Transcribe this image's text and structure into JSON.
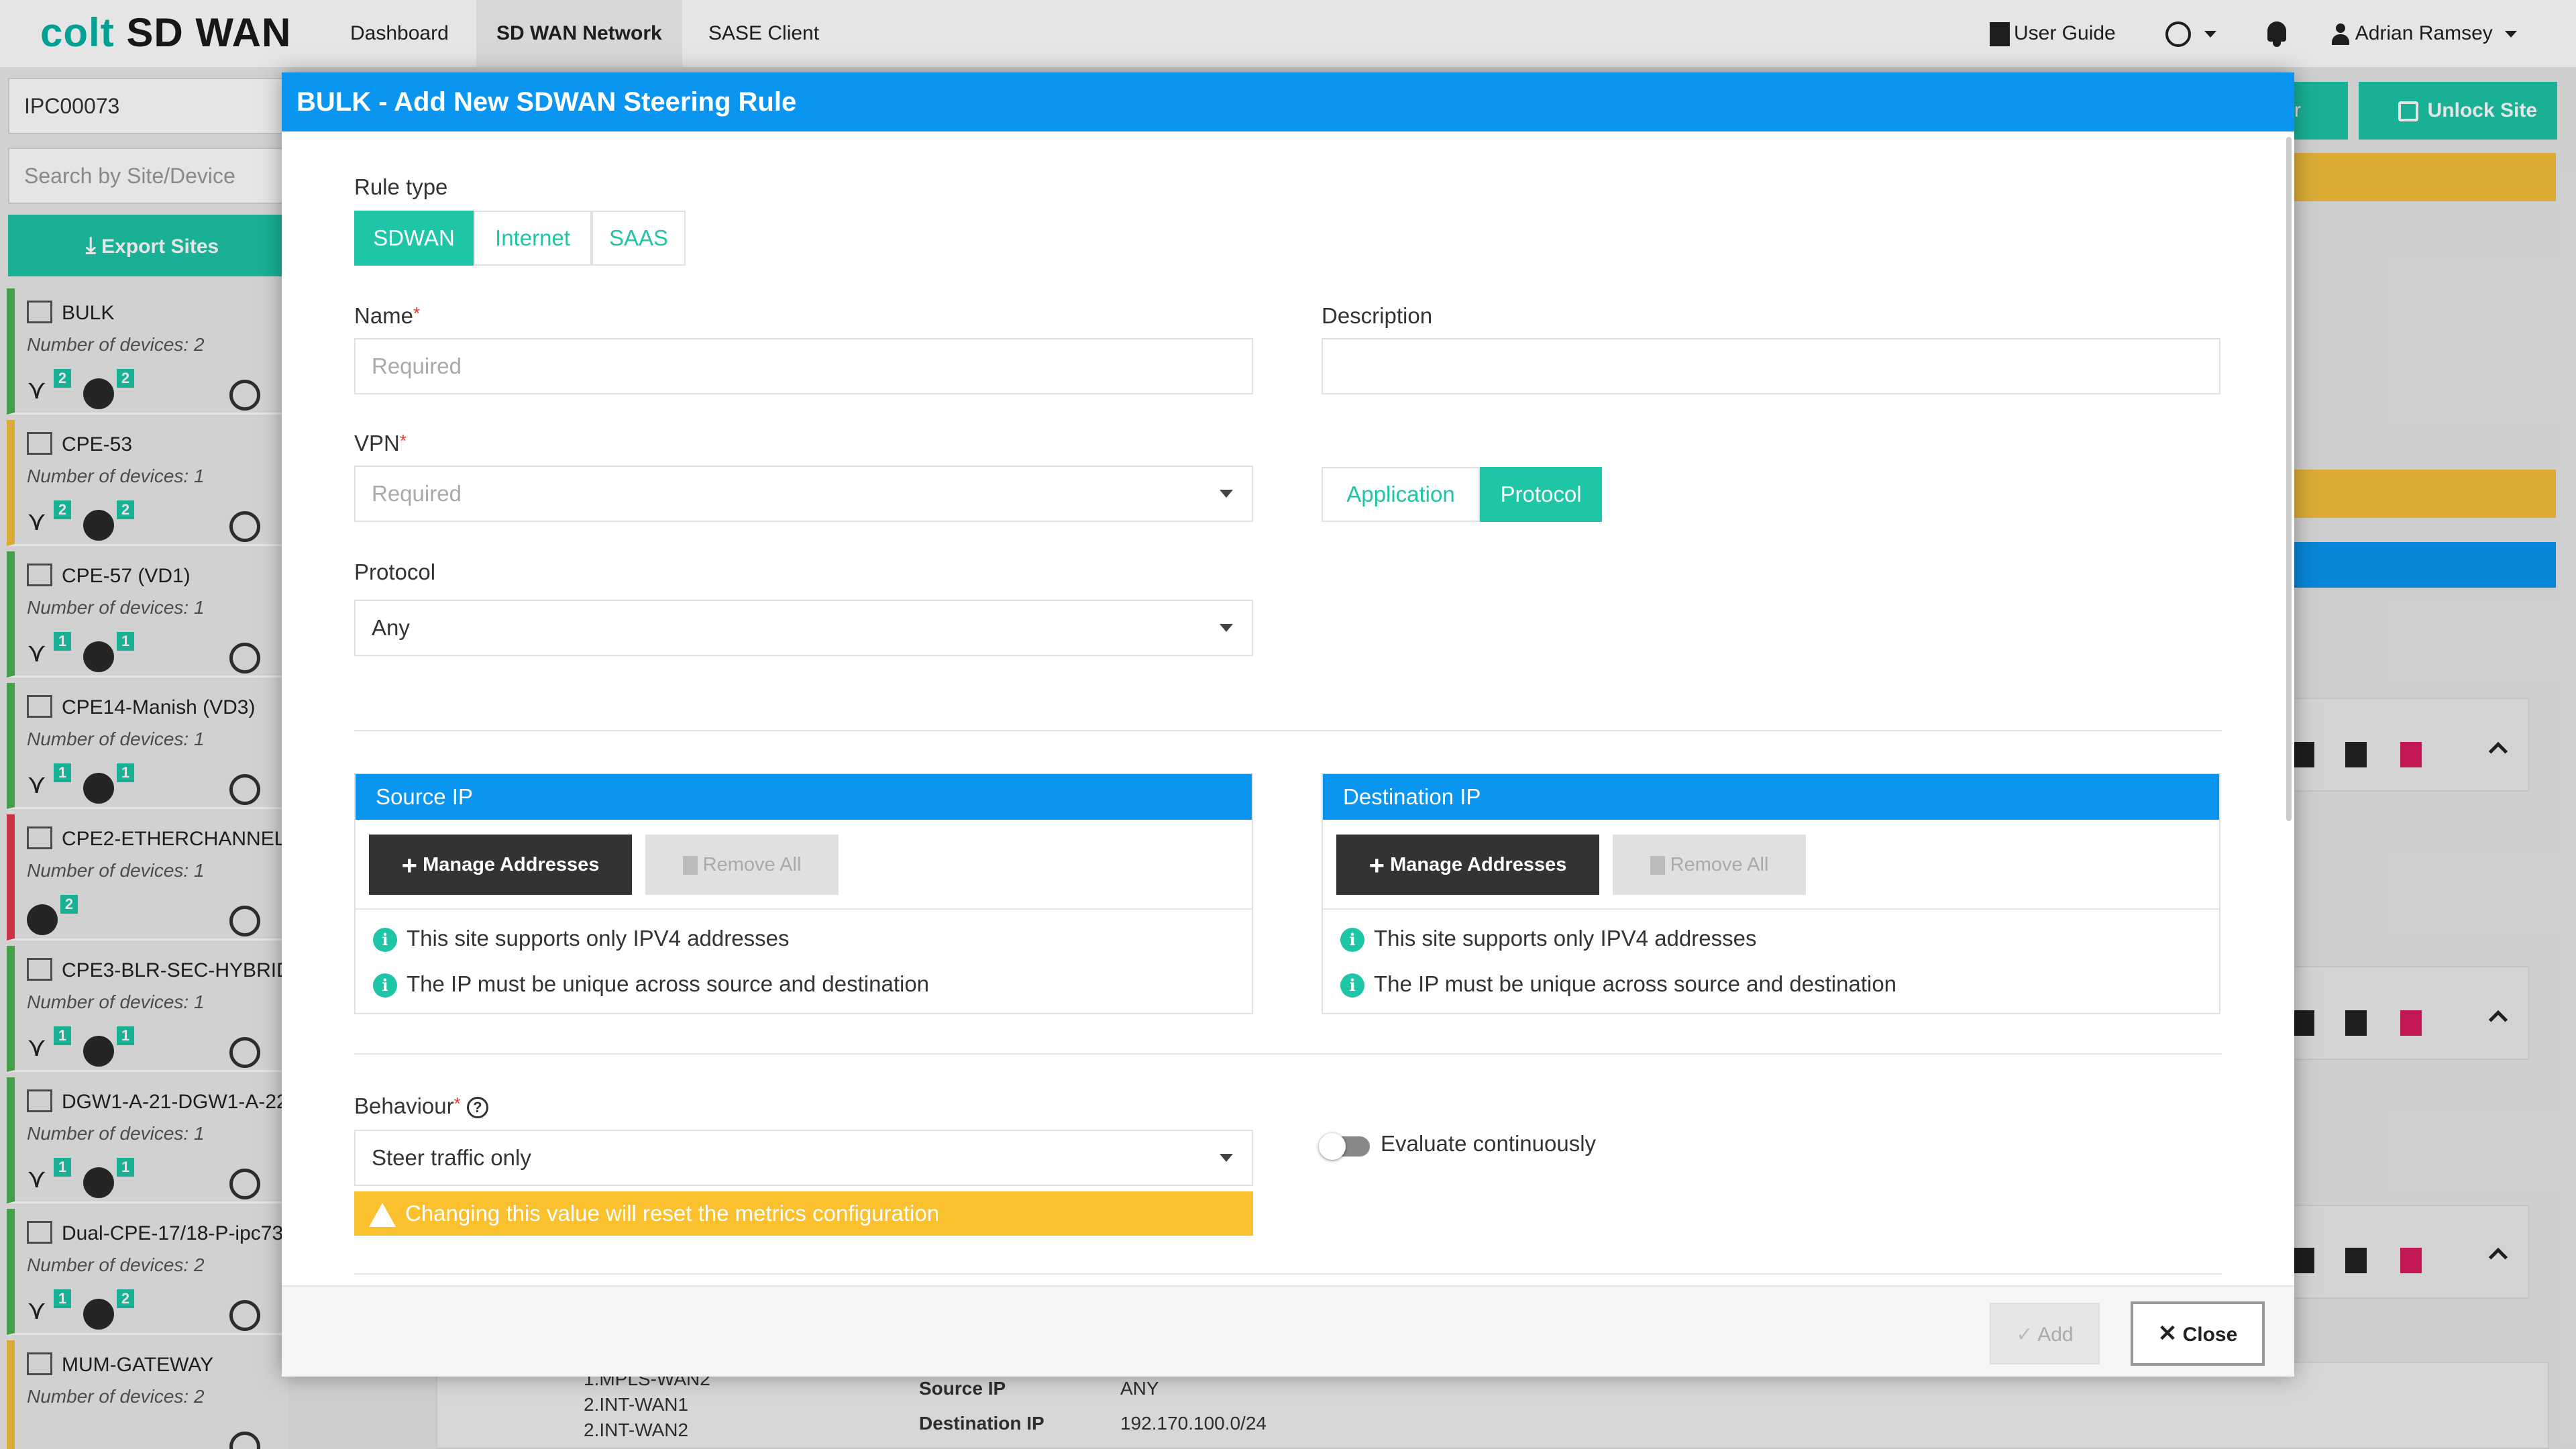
{
  "app": {
    "brand_prefix": "colt",
    "brand_suffix": "SD WAN",
    "nav": [
      {
        "label": "Dashboard",
        "active": false
      },
      {
        "label": "SD WAN Network",
        "active": true
      },
      {
        "label": "SASE Client",
        "active": false
      }
    ],
    "user_guide": "User Guide",
    "user_name": "Adrian Ramsey"
  },
  "sidebar": {
    "customer_value": "IPC00073",
    "search_placeholder": "Search by Site/Device",
    "export_label": "Export Sites",
    "sites": [
      {
        "name": "BULK",
        "devices": "Number of devices: 2",
        "topo": "2",
        "globe": "2",
        "status": "#4caf50"
      },
      {
        "name": "CPE-53",
        "devices": "Number of devices: 1",
        "topo": "2",
        "globe": "2",
        "status": "#f3c03d"
      },
      {
        "name": "CPE-57 (VD1)",
        "devices": "Number of devices: 1",
        "topo": "1",
        "globe": "1",
        "status": "#4caf50"
      },
      {
        "name": "CPE14-Manish (VD3)",
        "devices": "Number of devices: 1",
        "topo": "1",
        "globe": "1",
        "status": "#4caf50"
      },
      {
        "name": "CPE2-ETHERCHANNEL-",
        "devices": "Number of devices: 1",
        "topo": "",
        "globe": "2",
        "status": "#e53950"
      },
      {
        "name": "CPE3-BLR-SEC-HYBRID",
        "devices": "Number of devices: 1",
        "topo": "1",
        "globe": "1",
        "status": "#4caf50"
      },
      {
        "name": "DGW1-A-21-DGW1-A-22",
        "devices": "Number of devices: 1",
        "topo": "1",
        "globe": "1",
        "status": "#4caf50"
      },
      {
        "name": "Dual-CPE-17/18-P-ipc73",
        "devices": "Number of devices: 2",
        "topo": "1",
        "globe": "2",
        "status": "#4caf50"
      },
      {
        "name": "MUM-GATEWAY",
        "devices": "Number of devices: 2",
        "topo": "",
        "globe": "",
        "status": "#f3c03d"
      }
    ]
  },
  "background": {
    "unlock_label": "Unlock Site",
    "left_cut_label": "r",
    "wan_lines": [
      "1.MPLS-WAN2",
      "2.INT-WAN1",
      "2.INT-WAN2"
    ],
    "source_ip_label": "Source IP",
    "source_ip_value": "ANY",
    "dest_ip_label": "Destination IP",
    "dest_ip_value": "192.170.100.0/24"
  },
  "modal": {
    "title": "BULK - Add New SDWAN Steering Rule",
    "rule_type_label": "Rule type",
    "rule_types": [
      {
        "label": "SDWAN",
        "active": true
      },
      {
        "label": "Internet",
        "active": false
      },
      {
        "label": "SAAS",
        "active": false
      }
    ],
    "name_label": "Name",
    "name_placeholder": "Required",
    "description_label": "Description",
    "vpn_label": "VPN",
    "vpn_placeholder": "Required",
    "match_types": [
      {
        "label": "Application",
        "active": false
      },
      {
        "label": "Protocol",
        "active": true
      }
    ],
    "protocol_label": "Protocol",
    "protocol_value": "Any",
    "source": {
      "header": "Source IP",
      "manage_label": "Manage Addresses",
      "remove_label": "Remove All",
      "info1": "This site supports only IPV4 addresses",
      "info2": "The IP must be unique across source and destination"
    },
    "destination": {
      "header": "Destination IP",
      "manage_label": "Manage Addresses",
      "remove_label": "Remove All",
      "info1": "This site supports only IPV4 addresses",
      "info2": "The IP must be unique across source and destination"
    },
    "behaviour_label": "Behaviour",
    "behaviour_value": "Steer traffic only",
    "behaviour_warning": "Changing this value will reset the metrics configuration",
    "evaluate_label": "Evaluate continuously",
    "add_label": "Add",
    "close_label": "Close"
  },
  "colors": {
    "accent": "#1ec5a6",
    "header_blue": "#0a96f0",
    "warning": "#fbc02d"
  }
}
